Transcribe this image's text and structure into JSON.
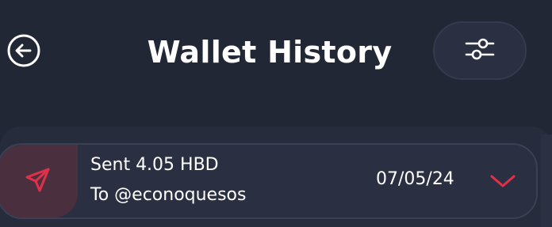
{
  "header": {
    "title": "Wallet History",
    "back_icon": "arrow-left-circle-icon",
    "filter_icon": "sliders-icon"
  },
  "transactions": [
    {
      "title": "Sent 4.05 HBD",
      "subtitle": "To @econoquesos",
      "date": "07/05/24",
      "type_icon": "send-paper-plane-icon",
      "expand_icon": "chevron-down-icon"
    }
  ],
  "colors": {
    "background": "#222736",
    "card": "#2a3041",
    "accent_red": "#e0304a",
    "text": "#ffffff"
  }
}
